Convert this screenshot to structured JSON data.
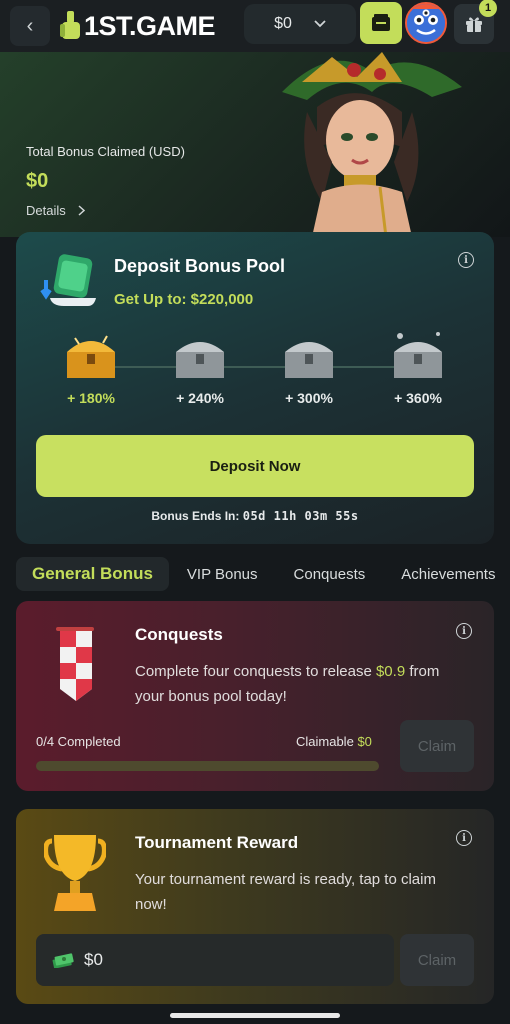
{
  "header": {
    "logo_text": "1ST.GAME",
    "balance": "$0",
    "notification_count": "1"
  },
  "hero": {
    "label": "Total Bonus Claimed (USD)",
    "amount": "$0",
    "details_link": "Details"
  },
  "deposit_pool": {
    "title": "Deposit Bonus Pool",
    "subtitle": "Get Up to: $220,000",
    "tiers": [
      {
        "label": "+ 180%",
        "active": true
      },
      {
        "label": "+ 240%",
        "active": false
      },
      {
        "label": "+ 300%",
        "active": false
      },
      {
        "label": "+ 360%",
        "active": false
      }
    ],
    "button_label": "Deposit Now",
    "ends_label": "Bonus Ends In:",
    "countdown": "05d 11h 03m 55s"
  },
  "tabs": [
    {
      "label": "General Bonus",
      "active": true
    },
    {
      "label": "VIP Bonus",
      "active": false
    },
    {
      "label": "Conquests",
      "active": false
    },
    {
      "label": "Achievements",
      "active": false
    }
  ],
  "conquests": {
    "title": "Conquests",
    "text_before": "Complete four conquests to release ",
    "text_highlight": "$0.9",
    "text_after": " from your bonus pool today!",
    "progress_label": "0/4 Completed",
    "progress_fraction": 0,
    "claimable_label": "Claimable",
    "claimable_amount": "$0",
    "claim_label": "Claim"
  },
  "tournament": {
    "title": "Tournament Reward",
    "text": "Your tournament reward is ready, tap to claim now!",
    "amount": "$0",
    "claim_label": "Claim"
  },
  "colors": {
    "accent": "#c3dd5a",
    "background": "#15191c"
  }
}
